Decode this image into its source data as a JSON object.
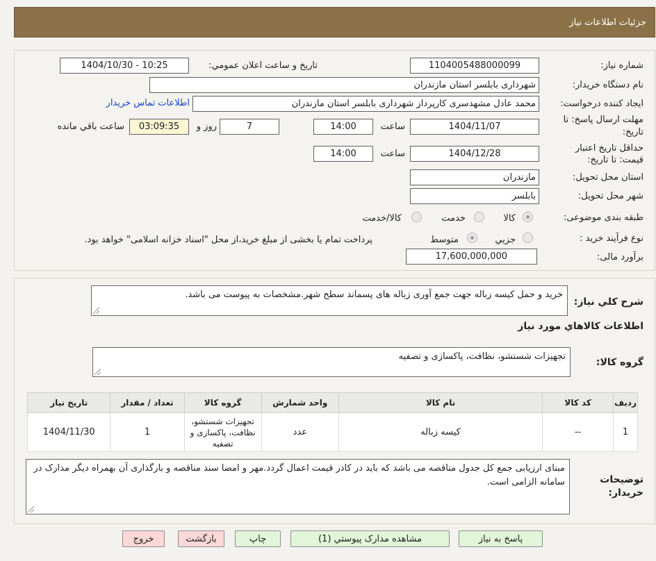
{
  "header": {
    "title": "جزئیات اطلاعات نیاز"
  },
  "form": {
    "need_number_label": "شماره نیاز:",
    "need_number": "1104005488000099",
    "announce_label": "تاریخ و ساعت اعلان عمومي:",
    "announce_value": "1404/10/30 - 10:25",
    "buyer_org_label": "نام دستگاه خریدار:",
    "buyer_org": "شهرداری بابلسر استان مازندران",
    "creator_label": "ایجاد کننده درخواست:",
    "creator": "محمد عادل مشهدسری کارپرداز شهرداری بابلسر استان مازندران",
    "contact_link": "اطلاعات تماس خریدار",
    "deadline_label_1": "مهلت ارسال پاسخ: تا",
    "deadline_label_2": "تاریخ:",
    "deadline_date": "1404/11/07",
    "time_label": "ساعت",
    "deadline_time": "14:00",
    "days": "7",
    "days_and": "روز و",
    "remaining": "03:09:35",
    "remaining_label": "ساعت باقي مانده",
    "validity_label_1": "حداقل تاریخ اعتبار",
    "validity_label_2": "قیمت: تا تاریخ:",
    "validity_date": "1404/12/28",
    "validity_time": "14:00",
    "province_label": "استان محل تحویل:",
    "province": "مازندران",
    "city_label": "شهر محل تحویل:",
    "city": "بابلسر",
    "category_label": "طبقه بندی موضوعی:",
    "category_options": [
      "کالا",
      "خدمت",
      "کالا/خدمت"
    ],
    "process_label": "نوع فرآیند خرید :",
    "process_options": [
      "جزیي",
      "متوسط"
    ],
    "process_note": "پرداخت تمام یا بخشی از مبلغ خرید،از محل \"اسناد خزانه اسلامی\" خواهد بود.",
    "budget_label": "برآورد مالی:",
    "budget": "17,600,000,000"
  },
  "summary": {
    "label": "شرح کلي نیاز:",
    "text": "خرید و حمل کیسه زباله جهت جمع آوری زباله های پسماند سطح شهر.مشخصات به پیوست می باشد."
  },
  "goods": {
    "section_title": "اطلاعات کالاهاي مورد نیاز",
    "group_label": "گروه کالا:",
    "group_value": "تجهیزات شستشو، نظافت، پاکسازی و تصفیه",
    "columns": [
      "ردیف",
      "کد کالا",
      "نام کالا",
      "واحد شمارش",
      "گروه کالا",
      "تعداد / مقدار",
      "تاریخ نیاز"
    ],
    "rows": [
      {
        "index": "1",
        "code": "--",
        "name": "کیسه زباله",
        "unit": "عدد",
        "group": "تجهیزات شستشو، نظافت، پاکسازی و تصفیه",
        "qty": "1",
        "date": "1404/11/30"
      }
    ]
  },
  "notes": {
    "label_1": "توضیحات",
    "label_2": "خریدار:",
    "text": "مبنای ارزیابی جمع کل جدول مناقصه می باشد که باید در کادر قیمت اعمال گردد.مهر و امضا سند مناقصه و بارگذاری آن بهمراه دیگر مدارک در سامانه الزامی است."
  },
  "buttons": {
    "reply": "پاسخ به نیاز",
    "attachments": "مشاهده مدارک پیوستي (1)",
    "print": "چاپ",
    "back": "بازگشت",
    "exit": "خروج"
  },
  "colors": {
    "header_bg": "#8b7147",
    "link": "#1a44c4",
    "button_green": "#e1f5d9",
    "button_pink": "#fbd8d8",
    "highlight_yellow": "#fcf6d2"
  }
}
